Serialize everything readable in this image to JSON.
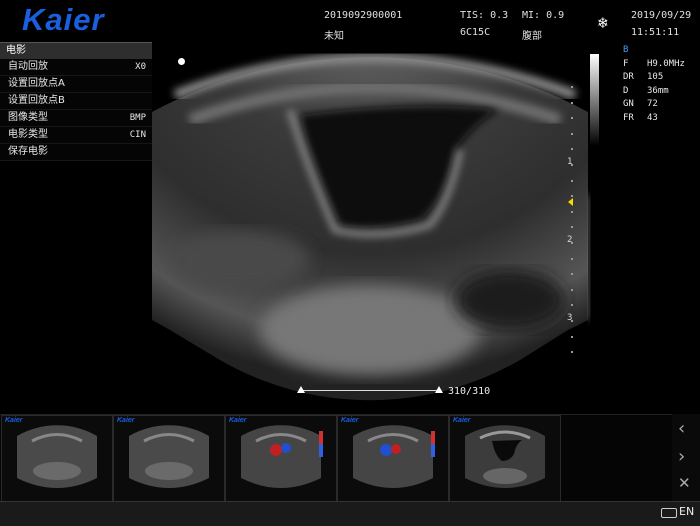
{
  "brand": {
    "logo": "Kaier",
    "thumb_logo": "Kaier"
  },
  "header": {
    "patient_id": "2019092900001",
    "patient_name": "未知",
    "tis": "TIS: 0.3",
    "mi": "MI: 0.9",
    "probe": "6C15C",
    "exam": "腹部",
    "date": "2019/09/29",
    "time": "11:51:11",
    "freeze_icon": "snowflake-icon"
  },
  "menu": {
    "title": "电影",
    "items": [
      {
        "label": "自动回放",
        "value": "X0"
      },
      {
        "label": "设置回放点A",
        "value": ""
      },
      {
        "label": "设置回放点B",
        "value": ""
      },
      {
        "label": "图像类型",
        "value": "BMP"
      },
      {
        "label": "电影类型",
        "value": "CIN"
      },
      {
        "label": "保存电影",
        "value": ""
      }
    ]
  },
  "params": {
    "mode": "B",
    "rows": [
      {
        "k": "F",
        "v": "H9.0MHz"
      },
      {
        "k": "DR",
        "v": "105"
      },
      {
        "k": "D",
        "v": "36mm"
      },
      {
        "k": "GN",
        "v": "72"
      },
      {
        "k": "FR",
        "v": "43"
      }
    ]
  },
  "depth_labels": [
    "1",
    "2",
    "3"
  ],
  "cine": {
    "counter": "310/310"
  },
  "thumbnails": [
    {
      "type": "b-mode"
    },
    {
      "type": "b-mode"
    },
    {
      "type": "color-doppler"
    },
    {
      "type": "color-doppler"
    },
    {
      "type": "b-mode-bladder"
    }
  ],
  "footer": {
    "language": "EN",
    "keyboard_icon": "keyboard-icon"
  },
  "colors": {
    "logo": "#1a5fe0",
    "mode": "#3fa0ff",
    "marker": "#ffd800"
  }
}
